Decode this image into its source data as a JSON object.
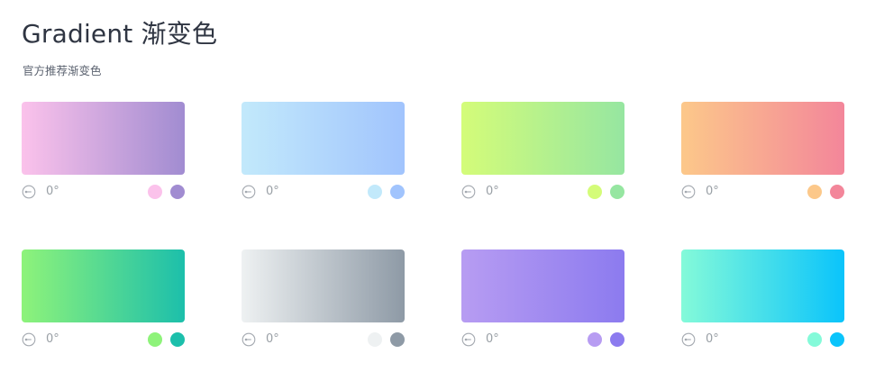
{
  "header": {
    "title": "Gradient 渐变色",
    "subtitle": "官方推荐渐变色"
  },
  "gradients": [
    {
      "angle_label": "0°",
      "icon": "angle-icon",
      "start": "#fbc2eb",
      "end": "#a18cd1"
    },
    {
      "angle_label": "0°",
      "icon": "angle-icon",
      "start": "#c2e9fb",
      "end": "#a1c4fd"
    },
    {
      "angle_label": "0°",
      "icon": "angle-icon",
      "start": "#d4fc79",
      "end": "#96e6a1"
    },
    {
      "angle_label": "0°",
      "icon": "angle-icon",
      "start": "#fcc88a",
      "end": "#f3869a"
    },
    {
      "angle_label": "0°",
      "icon": "angle-icon",
      "start": "#8ef37a",
      "end": "#1cbfab"
    },
    {
      "angle_label": "0°",
      "icon": "angle-icon",
      "start": "#eef1f2",
      "end": "#8e9aa6"
    },
    {
      "angle_label": "0°",
      "icon": "angle-icon",
      "start": "#b79cf2",
      "end": "#8c7bef"
    },
    {
      "angle_label": "0°",
      "icon": "angle-icon",
      "start": "#84fad9",
      "end": "#0ac4fb"
    }
  ]
}
